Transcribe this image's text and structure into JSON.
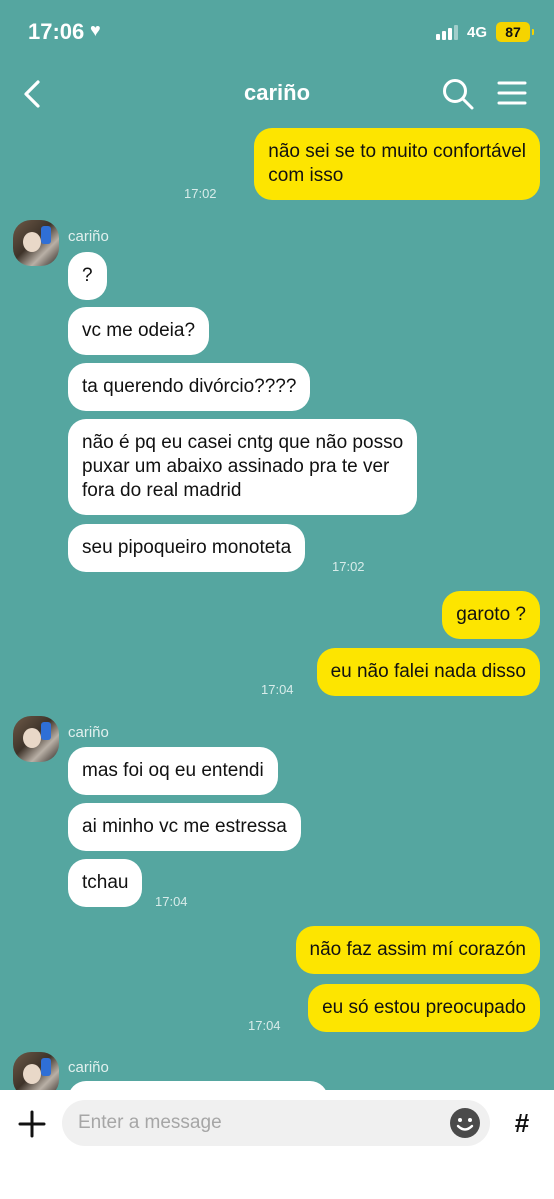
{
  "status_bar": {
    "time": "17:06",
    "network": "4G",
    "battery": "87"
  },
  "header": {
    "title": "cariño"
  },
  "messages": [
    {
      "text": "não sei se to muito confortável\ncom isso",
      "time": "17:02"
    },
    {
      "sender": "cariño"
    },
    {
      "text": "?"
    },
    {
      "text": "vc me odeia?"
    },
    {
      "text": "ta querendo divórcio????"
    },
    {
      "text": "não é pq eu casei cntg que não posso\npuxar um abaixo assinado pra te ver\nfora do real madrid"
    },
    {
      "text": "seu pipoqueiro monoteta",
      "time": "17:02"
    },
    {
      "text": "garoto ?"
    },
    {
      "text": "eu não falei nada disso",
      "time": "17:04"
    },
    {
      "sender": "cariño"
    },
    {
      "text": "mas foi oq eu entendi"
    },
    {
      "text": "ai minho vc me estressa"
    },
    {
      "text": "tchau",
      "time": "17:04"
    },
    {
      "text": "não faz assim mí corazón"
    },
    {
      "text": "eu só estou preocupado",
      "time": "17:04"
    },
    {
      "sender": "cariño"
    }
  ],
  "composer": {
    "placeholder": "Enter a message",
    "hash_label": "#"
  }
}
